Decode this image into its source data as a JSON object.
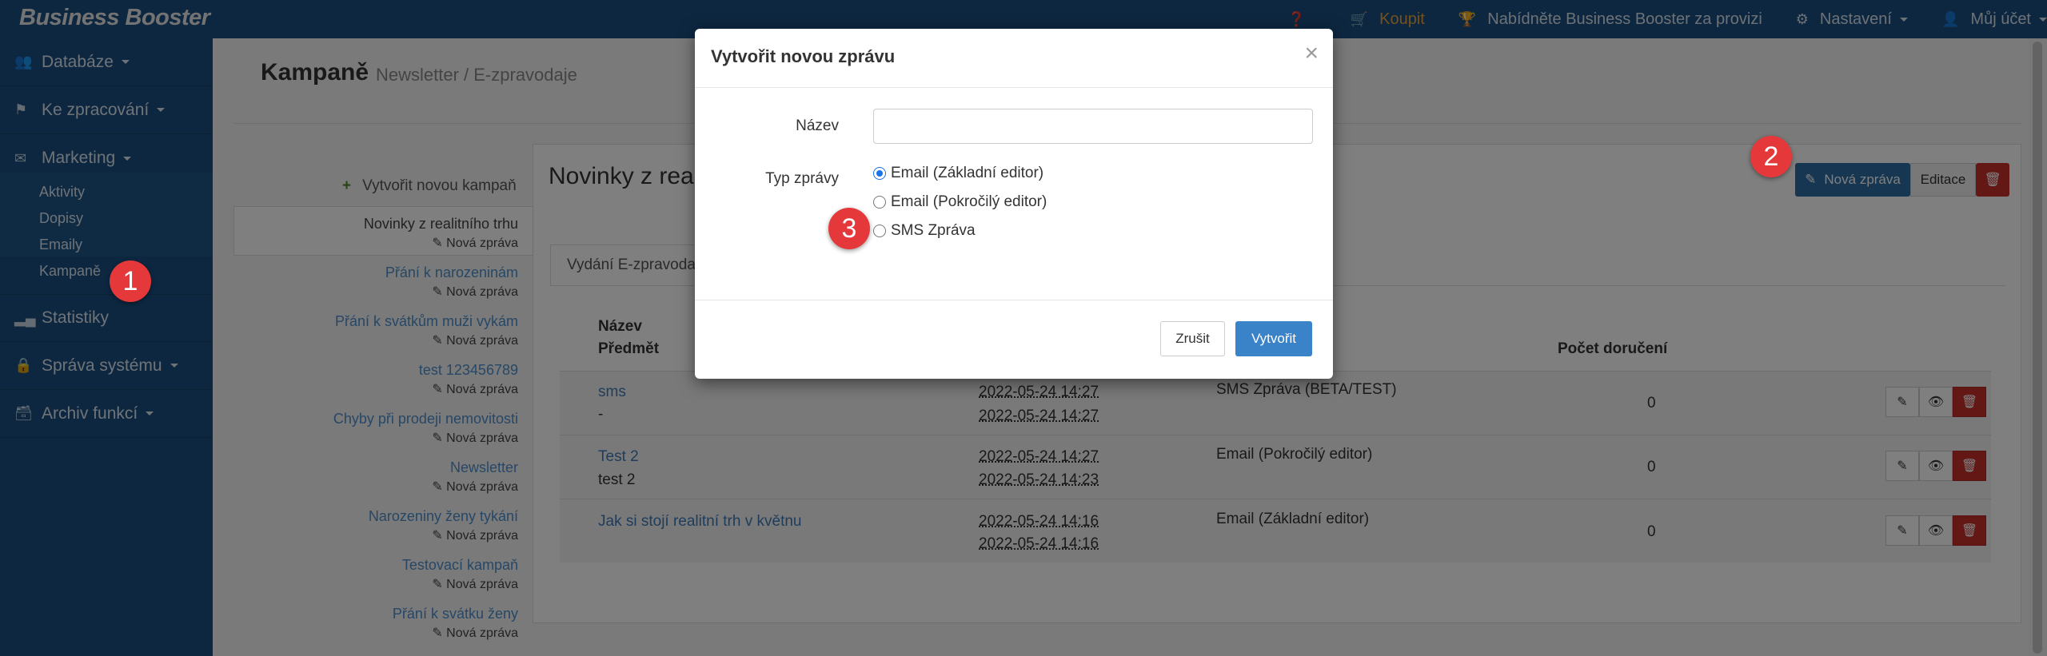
{
  "topbar": {
    "brand": "Business Booster",
    "help_icon": "question-circle-icon",
    "buy": "Koupit",
    "offer": "Nabídněte Business Booster za provizi",
    "settings": "Nastavení",
    "account": "Můj účet",
    "buy_color": "#e8a33a"
  },
  "sidebar": {
    "items": [
      {
        "label": "Databáze",
        "icon": "users-icon"
      },
      {
        "label": "Ke zpracování",
        "icon": "flag-icon"
      },
      {
        "label": "Marketing",
        "icon": "envelope-icon"
      },
      {
        "label": "Statistiky",
        "icon": "signal-icon"
      },
      {
        "label": "Správa systému",
        "icon": "lock-icon"
      },
      {
        "label": "Archiv funkcí",
        "icon": "archive-icon"
      }
    ],
    "marketing_sub": [
      "Aktivity",
      "Dopisy",
      "Emaily",
      "Kampaně"
    ]
  },
  "page": {
    "title": "Kampaně",
    "subtitle": "Newsletter / E-zpravodaje",
    "create_campaign": "Vytvořit novou kampaň"
  },
  "campaigns": [
    {
      "name": "Novinky z realitního trhu",
      "action": "Nová zpráva"
    },
    {
      "name": "Přání k narozeninám",
      "action": "Nová zpráva"
    },
    {
      "name": "Přání k svátkům muži vykám",
      "action": "Nová zpráva"
    },
    {
      "name": "test 123456789",
      "action": "Nová zpráva"
    },
    {
      "name": "Chyby při prodeji nemovitosti",
      "action": "Nová zpráva"
    },
    {
      "name": "Newsletter",
      "action": "Nová zpráva"
    },
    {
      "name": "Narozeniny ženy tykání",
      "action": "Nová zpráva"
    },
    {
      "name": "Testovací kampaň",
      "action": "Nová zpráva"
    },
    {
      "name": "Přání k svátku ženy",
      "action": "Nová zpráva"
    }
  ],
  "panel": {
    "title": "Novinky z real",
    "btn_new": "Nová zpráva",
    "btn_edit": "Editace",
    "tab": "Vydání E-zpravodaj"
  },
  "table": {
    "col_name": "Název",
    "col_subject": "Předmět",
    "col_delivered": "Počet doručení",
    "rows": [
      {
        "name": "sms",
        "subject": "-",
        "date1": "2022-05-24 14:27",
        "date2": "2022-05-24 14:27",
        "type": "SMS Zpráva (BETA/TEST)",
        "count": "0"
      },
      {
        "name": "Test 2",
        "subject": "test 2",
        "date1": "2022-05-24 14:27",
        "date2": "2022-05-24 14:23",
        "type": "Email (Pokročilý editor)",
        "count": "0"
      },
      {
        "name": "Jak si stojí realitní trh v květnu",
        "subject": "",
        "date1": "2022-05-24 14:16",
        "date2": "2022-05-24 14:16",
        "type": "Email (Základní editor)",
        "count": "0"
      }
    ]
  },
  "modal": {
    "title": "Vytvořit novou zprávu",
    "close": "×",
    "name_label": "Název",
    "name_value": "",
    "type_label": "Typ zprávy",
    "options": [
      "Email (Základní editor)",
      "Email (Pokročilý editor)",
      "SMS Zpráva"
    ],
    "selected_option": "Email (Základní editor)",
    "cancel": "Zrušit",
    "create": "Vytvořit"
  },
  "callouts": [
    "1",
    "2",
    "3"
  ]
}
